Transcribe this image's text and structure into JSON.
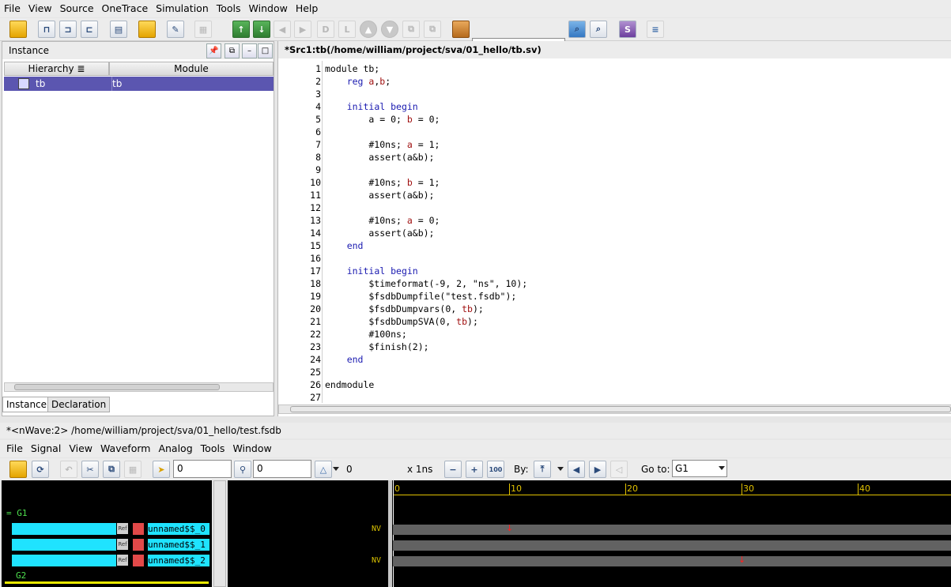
{
  "menubar": [
    "File",
    "View",
    "Source",
    "OneTrace",
    "Simulation",
    "Tools",
    "Window",
    "Help"
  ],
  "instance_panel": {
    "title": "Instance",
    "columns": [
      "Hierarchy",
      "Module"
    ],
    "row": {
      "name": "tb",
      "module": "tb"
    },
    "tabs": [
      "Instance",
      "Declaration"
    ]
  },
  "source": {
    "title": "*Src1:tb(/home/william/project/sva/01_hello/tb.sv)",
    "lines": [
      "module tb;",
      "    reg a,b;",
      "",
      "    initial begin",
      "        a = 0; b = 0;",
      "",
      "        #10ns; a = 1;",
      "        assert(a&b);",
      "",
      "        #10ns; b = 1;",
      "        assert(a&b);",
      "",
      "        #10ns; a = 0;",
      "        assert(a&b);",
      "    end",
      "",
      "    initial begin",
      "        $timeformat(-9, 2, \"ns\", 10);",
      "        $fsdbDumpfile(\"test.fsdb\");",
      "        $fsdbDumpvars(0, tb);",
      "        $fsdbDumpSVA(0, tb);",
      "        #100ns;",
      "        $finish(2);",
      "    end",
      "",
      "endmodule",
      ""
    ]
  },
  "wave": {
    "title": "*<nWave:2> /home/william/project/sva/01_hello/test.fsdb",
    "menubar": [
      "File",
      "Signal",
      "View",
      "Waveform",
      "Analog",
      "Tools",
      "Window"
    ],
    "cursor_value": "0",
    "marker_value": "0",
    "delta_value": "0",
    "time_unit": "x 1ns",
    "by_label": "By:",
    "goto_label": "Go to:",
    "goto_value": "G1",
    "groups": [
      "G1",
      "G2"
    ],
    "signals": [
      {
        "name": "unnamed$$_0",
        "value": "NV"
      },
      {
        "name": "unnamed$$_1",
        "value": ""
      },
      {
        "name": "unnamed$$_2",
        "value": "NV"
      }
    ],
    "ruler": [
      "0",
      "10",
      "20",
      "30",
      "40"
    ],
    "tag_text": "Ref"
  }
}
